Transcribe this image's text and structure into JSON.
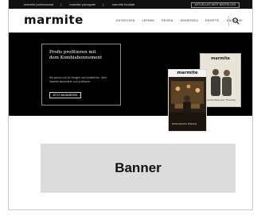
{
  "topbar": {
    "links": [
      "marmite professional",
      "marmite youngster",
      "marmite foodlab"
    ],
    "latest_button": "AKTUELLES HEFT BESTELLEN"
  },
  "header": {
    "logo": "marmite",
    "nav": [
      "ENTDECKEN",
      "LERNEN",
      "REISEN",
      "GENIESSEN",
      "REZEPTE",
      "MAGAZINE"
    ],
    "search_icon": "search-icon"
  },
  "hero": {
    "title": "Profis profitieren mit dem Kombiabonnement",
    "text": "Wir setzen uns für Neugier und Qualität ein. Jetzt marmite abonnieren und profitieren.",
    "button_label": "JETZT ABONNIEREN  →"
  },
  "magazines": {
    "front": {
      "logo": "marmite",
      "caption": "Kulinarische Heimat"
    },
    "back": {
      "logo": "marmite",
      "caption": "Geschichten der Freunde"
    }
  },
  "banner": {
    "label": "Banner"
  }
}
